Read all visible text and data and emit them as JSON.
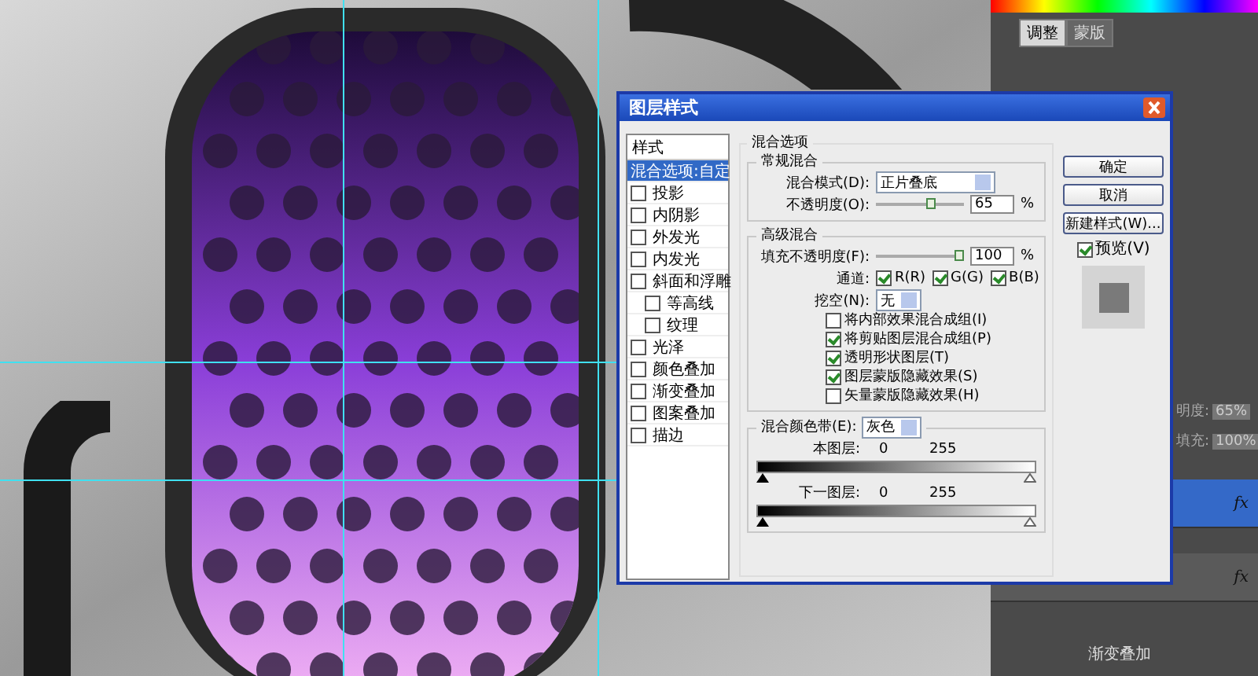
{
  "side_panel": {
    "tabs": [
      {
        "label": "调整",
        "selected": true
      },
      {
        "label": "蒙版",
        "selected": false
      }
    ],
    "opacity_label": "明度:",
    "opacity": "65%",
    "fill_label": "填充:",
    "fill": "100%",
    "layers": [
      {
        "fx": "fx",
        "selected": true
      },
      {
        "fx": "fx",
        "selected": false
      }
    ],
    "effect": "渐变叠加"
  },
  "dialog": {
    "title": "图层样式",
    "styles_header": "样式",
    "styles": [
      {
        "label": "混合选项:自定",
        "kind": "plain",
        "selected": true
      },
      {
        "label": "投影",
        "kind": "check",
        "checked": false,
        "selected": false
      },
      {
        "label": "内阴影",
        "kind": "check",
        "checked": false,
        "selected": false
      },
      {
        "label": "外发光",
        "kind": "check",
        "checked": false,
        "selected": false
      },
      {
        "label": "内发光",
        "kind": "check",
        "checked": false,
        "selected": false
      },
      {
        "label": "斜面和浮雕",
        "kind": "check",
        "checked": false,
        "selected": false,
        "children": [
          {
            "label": "等高线",
            "checked": false,
            "selected": false
          },
          {
            "label": "纹理",
            "checked": false,
            "selected": false
          }
        ]
      },
      {
        "label": "光泽",
        "kind": "check",
        "checked": false,
        "selected": false
      },
      {
        "label": "颜色叠加",
        "kind": "check",
        "checked": false,
        "selected": false
      },
      {
        "label": "渐变叠加",
        "kind": "check",
        "checked": false,
        "selected": false
      },
      {
        "label": "图案叠加",
        "kind": "check",
        "checked": false,
        "selected": false
      },
      {
        "label": "描边",
        "kind": "check",
        "checked": false,
        "selected": false
      }
    ],
    "blend_title": "混合选项",
    "general": {
      "title": "常规混合",
      "mode_label": "混合模式(D):",
      "mode": "正片叠底",
      "opacity_label": "不透明度(O):",
      "opacity": {
        "level": 0.65,
        "value": "65",
        "unit": "%"
      }
    },
    "advanced": {
      "title": "高级混合",
      "fill_label": "填充不透明度(F):",
      "fill": {
        "level": 1,
        "value": "100",
        "unit": "%"
      },
      "channels_label": "通道:",
      "channels": [
        {
          "label": "R(R)",
          "checked": true
        },
        {
          "label": "G(G)",
          "checked": true
        },
        {
          "label": "B(B)",
          "checked": true
        }
      ],
      "knockout_label": "挖空(N):",
      "knockout": "无",
      "options": [
        {
          "label": "将内部效果混合成组(I)",
          "checked": false
        },
        {
          "label": "将剪贴图层混合成组(P)",
          "checked": true
        },
        {
          "label": "透明形状图层(T)",
          "checked": true
        },
        {
          "label": "图层蒙版隐藏效果(S)",
          "checked": true
        },
        {
          "label": "矢量蒙版隐藏效果(H)",
          "checked": false
        }
      ]
    },
    "blend_if": {
      "label": "混合颜色带(E):",
      "value": "灰色",
      "ranges": [
        {
          "label": "本图层:",
          "low": "0",
          "high": "255"
        },
        {
          "label": "下一图层:",
          "low": "0",
          "high": "255"
        }
      ]
    },
    "buttons": [
      "确定",
      "取消",
      "新建样式(W)..."
    ],
    "preview": {
      "label": "预览(V)",
      "checked": true
    }
  }
}
